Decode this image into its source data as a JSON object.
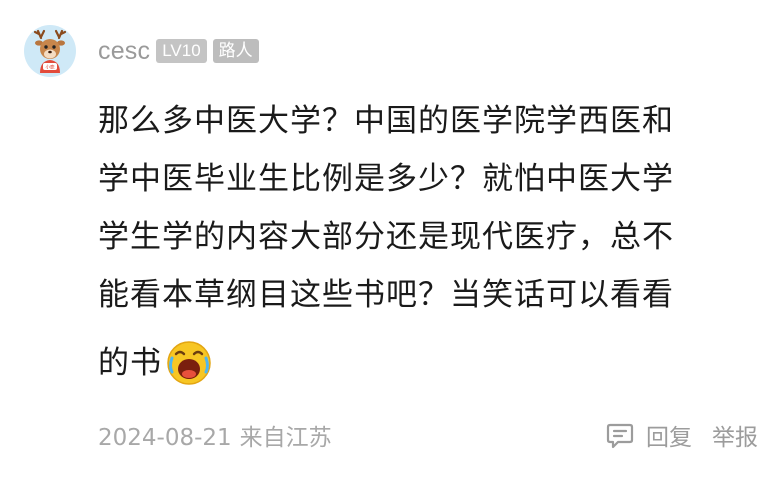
{
  "comment": {
    "username": "cesc",
    "level_badge": "LV10",
    "role_badge": "路人",
    "avatar_text": "小鹿",
    "lines": [
      "那么多中医大学？中国的医学院学西医和",
      "学中医毕业生比例是多少？就怕中医大学",
      "学生学的内容大部分还是现代医疗，总不",
      "能看本草纲目这些书吧？当笑话可以看看",
      "的书"
    ],
    "emoji": "laughing-crying-emoji",
    "date": "2024-08-21",
    "location": "来自江苏",
    "reply_label": "回复",
    "report_label": "举报"
  },
  "colors": {
    "text": "#1a1a1a",
    "meta": "#a8a8a8",
    "badge_bg": "#c4c4c4",
    "avatar_bg": "#cfe9f7"
  }
}
